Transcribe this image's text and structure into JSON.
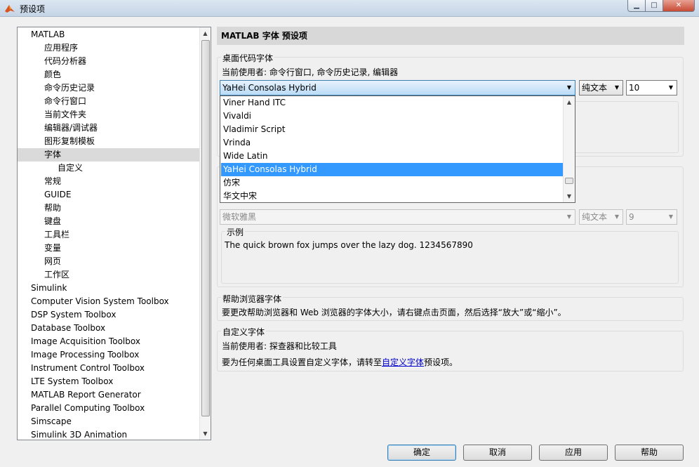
{
  "window": {
    "title": "预设项"
  },
  "tree": {
    "items": [
      {
        "label": "MATLAB",
        "level": 0
      },
      {
        "label": "应用程序",
        "level": 1
      },
      {
        "label": "代码分析器",
        "level": 1
      },
      {
        "label": "颜色",
        "level": 1
      },
      {
        "label": "命令历史记录",
        "level": 1
      },
      {
        "label": "命令行窗口",
        "level": 1
      },
      {
        "label": "当前文件夹",
        "level": 1
      },
      {
        "label": "编辑器/调试器",
        "level": 1
      },
      {
        "label": "图形复制模板",
        "level": 1
      },
      {
        "label": "字体",
        "level": 1,
        "selected": true
      },
      {
        "label": "自定义",
        "level": 2
      },
      {
        "label": "常规",
        "level": 1
      },
      {
        "label": "GUIDE",
        "level": 1
      },
      {
        "label": "帮助",
        "level": 1
      },
      {
        "label": "键盘",
        "level": 1
      },
      {
        "label": "工具栏",
        "level": 1
      },
      {
        "label": "变量",
        "level": 1
      },
      {
        "label": "网页",
        "level": 1
      },
      {
        "label": "工作区",
        "level": 1
      },
      {
        "label": "Simulink",
        "level": 0
      },
      {
        "label": "Computer Vision System Toolbox",
        "level": 0
      },
      {
        "label": "DSP System Toolbox",
        "level": 0
      },
      {
        "label": "Database Toolbox",
        "level": 0
      },
      {
        "label": "Image Acquisition Toolbox",
        "level": 0
      },
      {
        "label": "Image Processing Toolbox",
        "level": 0
      },
      {
        "label": "Instrument Control Toolbox",
        "level": 0
      },
      {
        "label": "LTE System Toolbox",
        "level": 0
      },
      {
        "label": "MATLAB Report Generator",
        "level": 0
      },
      {
        "label": "Parallel Computing Toolbox",
        "level": 0
      },
      {
        "label": "Simscape",
        "level": 0
      },
      {
        "label": "Simulink 3D Animation",
        "level": 0
      }
    ]
  },
  "panel": {
    "header": "MATLAB 字体 预设项",
    "desktop_code_font": {
      "group_label": "桌面代码字体",
      "usage": "当前使用者: 命令行窗口, 命令历史记录, 编辑器",
      "font_value": "YaHei Consolas Hybrid",
      "style_value": "纯文本",
      "size_value": "10"
    },
    "font_options": [
      {
        "label": "Viner Hand ITC"
      },
      {
        "label": "Vivaldi"
      },
      {
        "label": "Vladimir Script"
      },
      {
        "label": "Vrinda"
      },
      {
        "label": "Wide Latin"
      },
      {
        "label": "YaHei Consolas Hybrid",
        "selected": true
      },
      {
        "label": "仿宋"
      },
      {
        "label": "华文中宋"
      }
    ],
    "desktop_text_font": {
      "font_value": "微软雅黑",
      "style_value": "纯文本",
      "size_value": "9",
      "sample_label": "示例",
      "sample_text": "The quick brown fox jumps over the lazy dog.  1234567890"
    },
    "help_browser_font": {
      "group_label": "帮助浏览器字体",
      "text": "要更改帮助浏览器和 Web 浏览器的字体大小，请右键点击页面，然后选择“放大”或“缩小”。"
    },
    "custom_font": {
      "group_label": "自定义字体",
      "usage": "当前使用者: 探查器和比较工具",
      "text_before": "要为任何桌面工具设置自定义字体，请转至",
      "link": "自定义字体",
      "text_after": "预设项。"
    }
  },
  "buttons": {
    "ok": "确定",
    "cancel": "取消",
    "apply": "应用",
    "help": "帮助"
  }
}
